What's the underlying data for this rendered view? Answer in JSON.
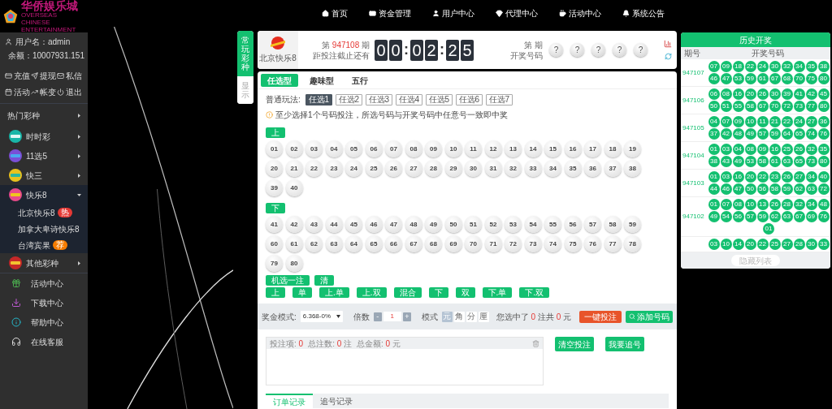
{
  "sidebar": {
    "logo": {
      "title": "华侨娱乐城",
      "subtitle": "OVERSEAS CHINESE ENTERTAINMENT"
    },
    "user": {
      "username_label": "用户名：",
      "username": "admin",
      "balance_label": "余额：",
      "balance": "10007931.151"
    },
    "actions": [
      "充值",
      "提现",
      "私信",
      "活动",
      "帐变",
      "退出"
    ],
    "menu": [
      {
        "label": "热门彩种",
        "kind": "header",
        "expanded": false
      },
      {
        "label": "时时彩",
        "kind": "lottery",
        "expanded": false
      },
      {
        "label": "11选5",
        "kind": "lottery",
        "expanded": false
      },
      {
        "label": "快三",
        "kind": "lottery",
        "expanded": false
      },
      {
        "label": "快乐8",
        "kind": "lottery",
        "expanded": true,
        "children": [
          {
            "label": "北京快乐8",
            "badge": "热",
            "color": "#e53935"
          },
          {
            "label": "加拿大卑诗快乐8"
          },
          {
            "label": "台湾宾果",
            "badge": "荐",
            "color": "#f57c00"
          }
        ]
      },
      {
        "label": "其他彩种",
        "kind": "lottery",
        "expanded": false
      }
    ],
    "links": [
      "活动中心",
      "下载中心",
      "帮助中心",
      "在线客服"
    ]
  },
  "nav": [
    "首页",
    "资金管理",
    "用户中心",
    "代理中心",
    "活动中心",
    "系统公告"
  ],
  "side_tabs": [
    {
      "label": "常玩彩种",
      "selected": true
    },
    {
      "label": "显示",
      "selected": false
    }
  ],
  "game": {
    "name": "北京快乐8",
    "issue_prefix": "第",
    "issue": "947108",
    "issue_suffix": "期",
    "deadline": "距投注截止还有",
    "countdown": [
      "0",
      "0",
      ":",
      "0",
      "2",
      ":",
      "2",
      "5"
    ],
    "last_issue_label": "第 期",
    "numbers_label": "开奖号码",
    "balls": [
      "?",
      "?",
      "?",
      "?",
      "?"
    ]
  },
  "play_tabs": [
    {
      "label": "任选型",
      "selected": true
    },
    {
      "label": "趣味型",
      "selected": false
    },
    {
      "label": "五行",
      "selected": false
    }
  ],
  "play_label": "普通玩法:",
  "play_options": [
    {
      "label": "任选1",
      "selected": true
    },
    {
      "label": "任选2",
      "selected": false
    },
    {
      "label": "任选3",
      "selected": false
    },
    {
      "label": "任选4",
      "selected": false
    },
    {
      "label": "任选5",
      "selected": false
    },
    {
      "label": "任选6",
      "selected": false
    },
    {
      "label": "任选7",
      "selected": false
    }
  ],
  "hint": "至少选择1个号码投注，所选号码与开奖号码中任意号一致即中奖",
  "groups": [
    {
      "label": "上",
      "numbers": [
        "01",
        "02",
        "03",
        "04",
        "05",
        "06",
        "07",
        "08",
        "09",
        "10",
        "11",
        "12",
        "13",
        "14",
        "15",
        "16",
        "17",
        "18",
        "19",
        "20",
        "21",
        "22",
        "23",
        "24",
        "25",
        "26",
        "27",
        "28",
        "29",
        "30",
        "31",
        "32",
        "33",
        "34",
        "35",
        "36",
        "37",
        "38",
        "39",
        "40"
      ]
    },
    {
      "label": "下",
      "numbers": [
        "41",
        "42",
        "43",
        "44",
        "45",
        "46",
        "47",
        "48",
        "49",
        "50",
        "51",
        "52",
        "53",
        "54",
        "55",
        "56",
        "57",
        "58",
        "59",
        "60",
        "61",
        "62",
        "63",
        "64",
        "65",
        "66",
        "67",
        "68",
        "69",
        "70",
        "71",
        "72",
        "73",
        "74",
        "75",
        "76",
        "77",
        "78",
        "79",
        "80"
      ]
    }
  ],
  "tools": [
    "机选一注",
    "清"
  ],
  "quick": [
    "上",
    "单",
    "上.单",
    "上.双",
    "混合",
    "下",
    "双",
    "下.单",
    "下.双"
  ],
  "bet_bar": {
    "prize_label": "奖金模式:",
    "prize_value": "6.368-0%",
    "multiplier_label": "倍数",
    "minus": "-",
    "multiplier": "1",
    "plus": "+",
    "mode_label": "模式",
    "modes": [
      {
        "label": "元",
        "selected": true
      },
      {
        "label": "角",
        "selected": false
      },
      {
        "label": "分",
        "selected": false
      },
      {
        "label": "厘",
        "selected": false
      }
    ],
    "summary": {
      "prefix": "您选中了",
      "count": "0",
      "middle": "注共",
      "amount": "0",
      "suffix": "元"
    },
    "quick_bet": "一键投注",
    "add": "添加号码"
  },
  "bet_list": {
    "items_label": "投注项:",
    "items": "0",
    "count_label": "总注数:",
    "count": "0",
    "count_unit": "注",
    "total_label": "总金额:",
    "total": "0",
    "total_unit": "元"
  },
  "bet_actions": [
    "清空投注",
    "我要追号"
  ],
  "record_tabs": [
    {
      "label": "订单记录",
      "selected": true
    },
    {
      "label": "追号记录",
      "selected": false
    }
  ],
  "history": {
    "title": "历史开奖",
    "columns": [
      "期号",
      "开奖号码"
    ],
    "rows": [
      {
        "issue": "947107",
        "numbers": [
          "07",
          "09",
          "18",
          "22",
          "24",
          "30",
          "32",
          "34",
          "35",
          "38",
          "46",
          "47",
          "53",
          "59",
          "61",
          "67",
          "68",
          "70",
          "75",
          "80"
        ]
      },
      {
        "issue": "947106",
        "numbers": [
          "06",
          "08",
          "16",
          "20",
          "26",
          "30",
          "39",
          "41",
          "42",
          "45",
          "50",
          "51",
          "55",
          "58",
          "67",
          "70",
          "72",
          "73",
          "77",
          "80"
        ]
      },
      {
        "issue": "947105",
        "numbers": [
          "04",
          "07",
          "09",
          "10",
          "11",
          "21",
          "22",
          "24",
          "27",
          "36",
          "37",
          "42",
          "48",
          "49",
          "57",
          "59",
          "64",
          "65",
          "74",
          "76"
        ]
      },
      {
        "issue": "947104",
        "numbers": [
          "01",
          "03",
          "04",
          "08",
          "09",
          "16",
          "25",
          "26",
          "32",
          "35",
          "38",
          "43",
          "49",
          "53",
          "58",
          "61",
          "63",
          "65",
          "73",
          "80"
        ]
      },
      {
        "issue": "947103",
        "numbers": [
          "01",
          "03",
          "16",
          "20",
          "22",
          "23",
          "26",
          "27",
          "34",
          "40",
          "44",
          "46",
          "47",
          "50",
          "56",
          "58",
          "59",
          "62",
          "63",
          "72"
        ]
      },
      {
        "issue": "947102",
        "numbers": [
          "01",
          "07",
          "08",
          "10",
          "13",
          "26",
          "28",
          "32",
          "34",
          "48",
          "49",
          "54",
          "56",
          "57",
          "59",
          "62",
          "63",
          "67",
          "69",
          "76",
          "01"
        ]
      },
      {
        "numbers": [
          "03",
          "10",
          "14",
          "20",
          "22",
          "25",
          "27",
          "28",
          "30",
          "33"
        ]
      }
    ],
    "hide_button": "隐藏列表"
  }
}
